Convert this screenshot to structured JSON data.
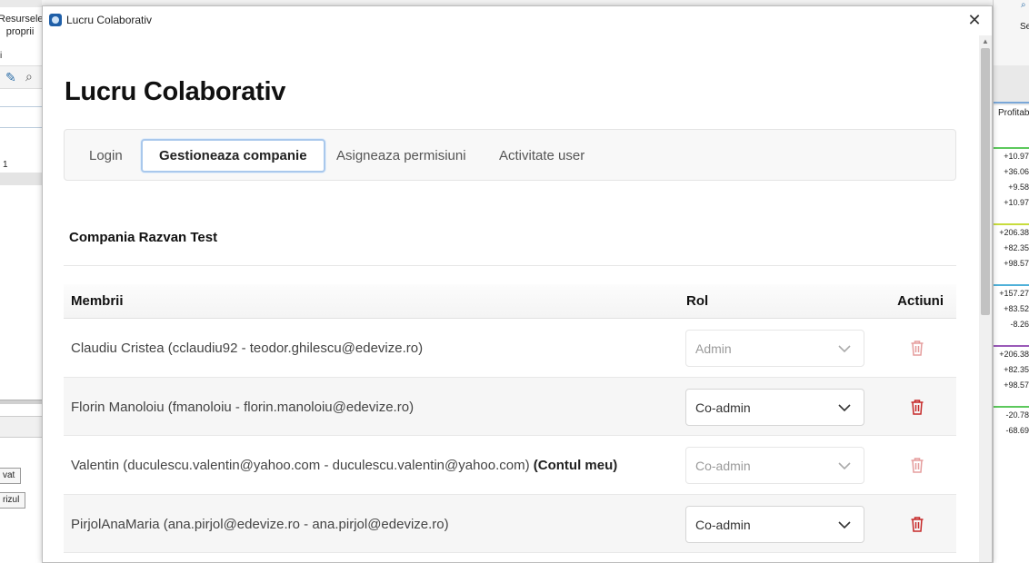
{
  "background_left": {
    "label_line1": "Resursele",
    "label_line2": "proprii",
    "i_text": "i",
    "row_number": "1",
    "button1": "vat",
    "button2": "rizul"
  },
  "background_right": {
    "header_text": "Se",
    "column_header": "Profitab",
    "values": [
      "+10.97",
      "+36.06",
      "+9.58",
      "+10.97",
      "+206.38",
      "+82.35",
      "+98.57",
      "+157.27",
      "+83.52",
      "-8.26",
      "+206.38",
      "+82.35",
      "+98.57",
      "-20.78",
      "-68.69"
    ],
    "line_colors": [
      "#5cc85c",
      "#c8dc3c",
      "#4fb0d8",
      "#9a5ab8",
      "#5cc85c"
    ]
  },
  "window": {
    "title": "Lucru Colaborativ",
    "close_glyph": "✕"
  },
  "page": {
    "title": "Lucru Colaborativ",
    "tabs": [
      {
        "label": "Login",
        "active": false
      },
      {
        "label": "Gestioneaza companie",
        "active": true
      },
      {
        "label": "Asigneaza permisiuni",
        "active": false
      },
      {
        "label": "Activitate user",
        "active": false
      }
    ],
    "company_title": "Compania Razvan Test"
  },
  "table": {
    "headers": {
      "members": "Membrii",
      "role": "Rol",
      "actions": "Actiuni"
    },
    "rows": [
      {
        "member": "Claudiu Cristea (cclaudiu92 - teodor.ghilescu@edevize.ro)",
        "suffix": "",
        "role": "Admin",
        "disabled": true
      },
      {
        "member": "Florin Manoloiu (fmanoloiu - florin.manoloiu@edevize.ro)",
        "suffix": "",
        "role": "Co-admin",
        "disabled": false
      },
      {
        "member": "Valentin (duculescu.valentin@yahoo.com - duculescu.valentin@yahoo.com)",
        "suffix": "(Contul meu)",
        "role": "Co-admin",
        "disabled": true
      },
      {
        "member": "PirjolAnaMaria (ana.pirjol@edevize.ro - ana.pirjol@edevize.ro)",
        "suffix": "",
        "role": "Co-admin",
        "disabled": false
      }
    ]
  },
  "colors": {
    "trash": "#c62828",
    "tab_active_border": "#a9c8ec"
  },
  "icons": {
    "role_dropdown": "chevron-down-icon",
    "delete": "trash-icon",
    "close": "close-icon"
  }
}
